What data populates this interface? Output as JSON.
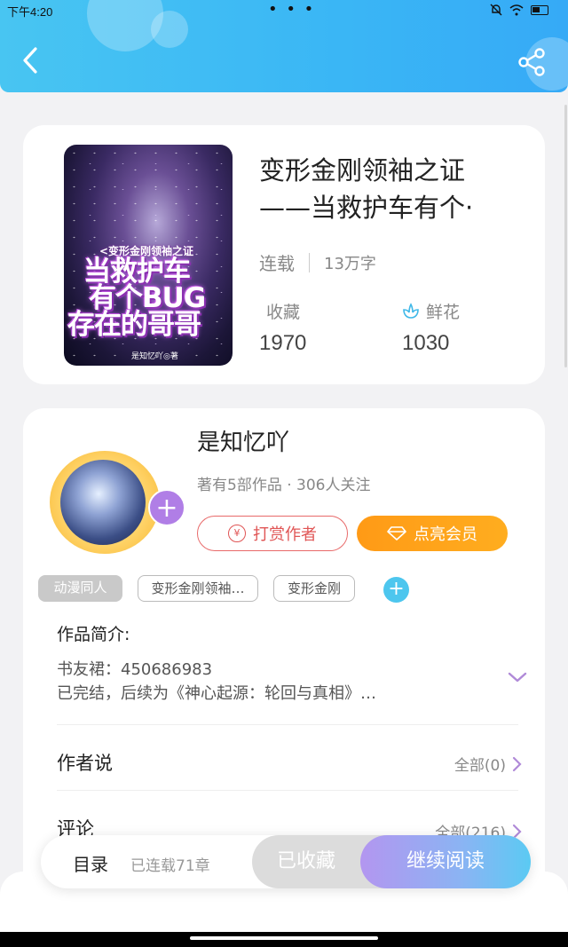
{
  "status_bar": {
    "time": "下午4:20",
    "dots": "• • •"
  },
  "header": {
    "back_icon": "chevron-left-icon",
    "share_icon": "share-icon",
    "color": "#3ab6f5"
  },
  "book": {
    "title_line1": "变形金刚领袖之证",
    "title_line2": "——当救护车有个·",
    "status": "连载",
    "word_count": "13万字",
    "favorites_label": "收藏",
    "favorites_value": "1970",
    "flowers_label": "鲜花",
    "flowers_value": "1030",
    "cover": {
      "subtitle": "<变形金刚领袖之证",
      "line1": "当救护车",
      "line2": "有个BUG",
      "line3": "存在的哥哥",
      "author": "是知忆吖◎著"
    }
  },
  "author": {
    "name": "是知忆吖",
    "info": "著有5部作品 · 306人关注",
    "follow_symbol": "+",
    "reward_label": "打赏作者",
    "yen_symbol": "¥",
    "vip_label": "点亮会员"
  },
  "tags": [
    "动漫同人",
    "变形金刚领袖…",
    "变形金刚"
  ],
  "tag_add": "+",
  "intro": {
    "heading": "作品简介:",
    "line1": "书友裙：450686983",
    "line2": "已完结，后续为《神心起源：轮回与真相》…"
  },
  "author_says": {
    "label": "作者说",
    "right": "全部(0)"
  },
  "comments": {
    "label": "评论",
    "right": "全部(216)"
  },
  "bottom_bar": {
    "toc_label": "目录",
    "toc_count": "已连载71章",
    "saved_label": "已收藏",
    "read_label": "继续阅读"
  }
}
